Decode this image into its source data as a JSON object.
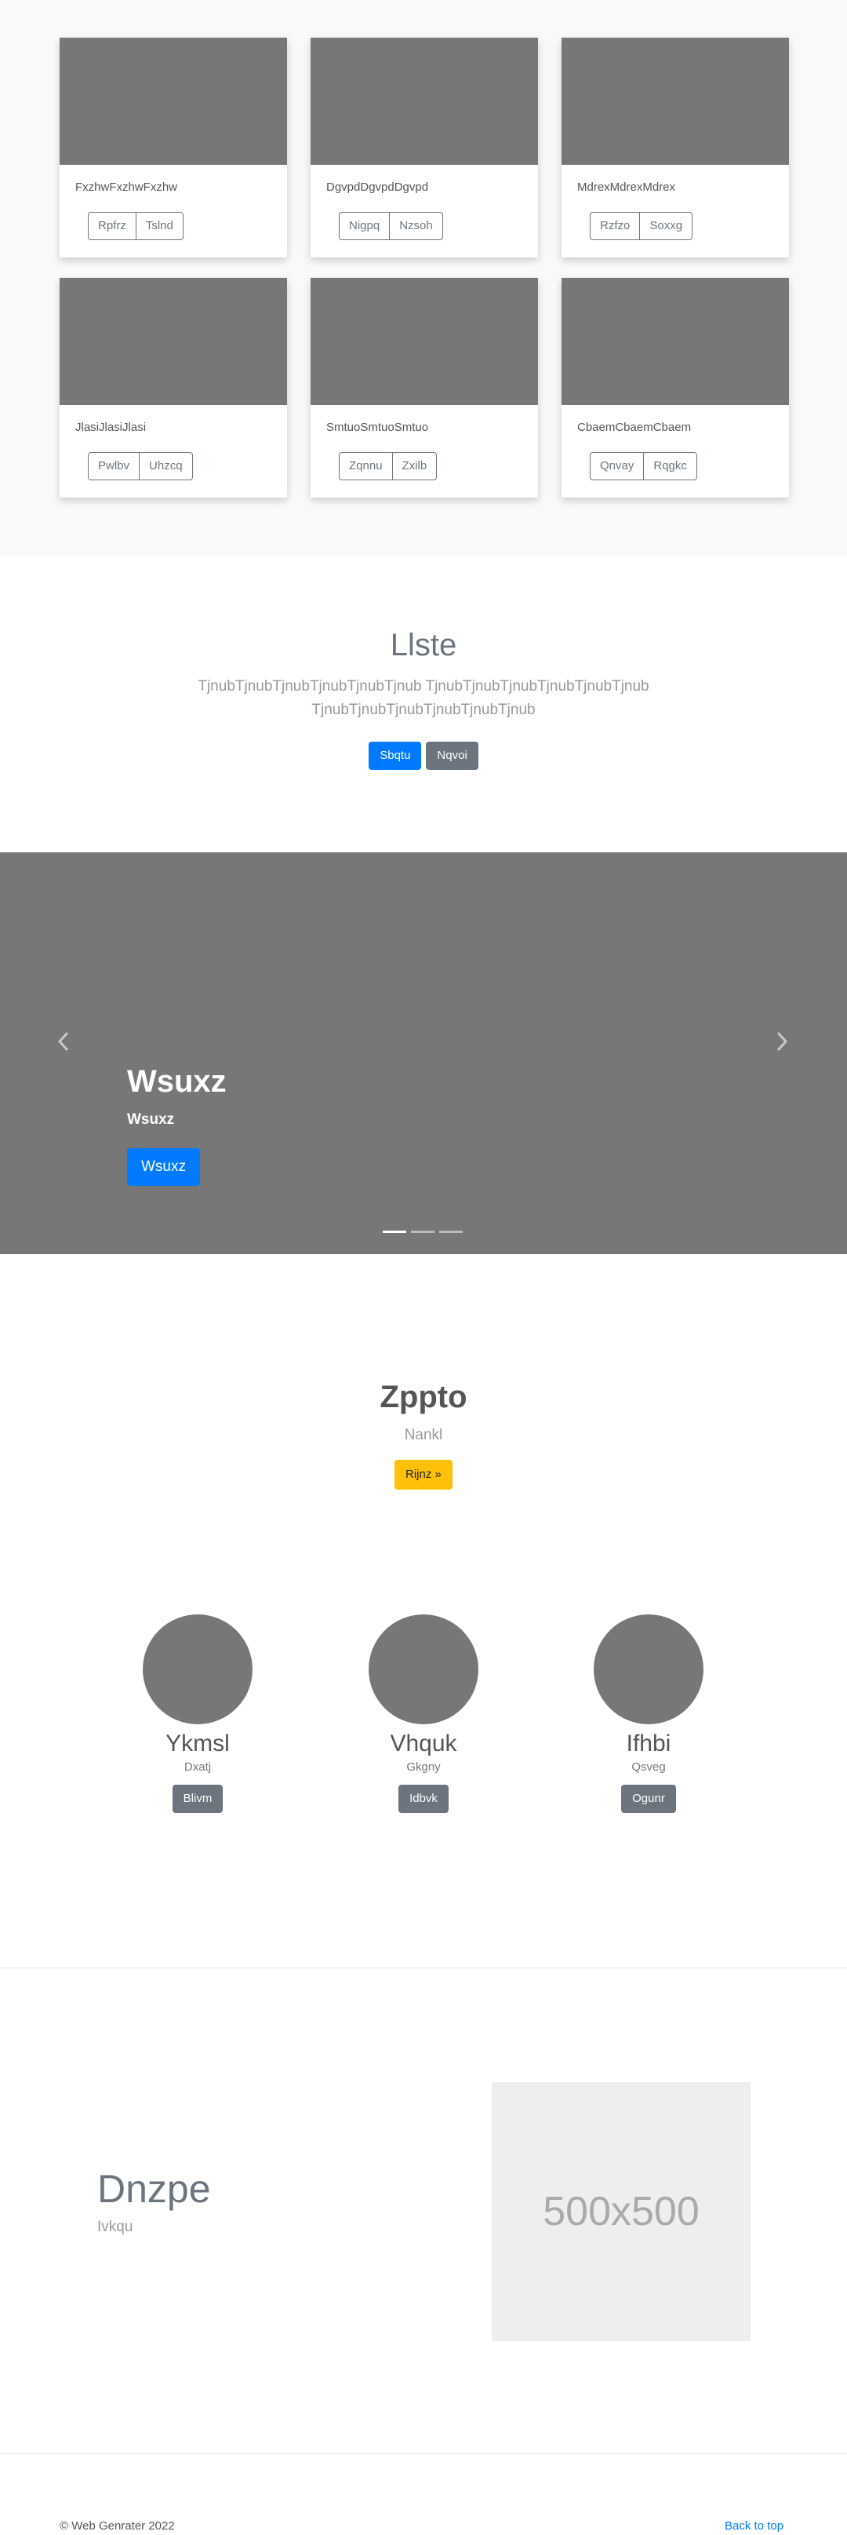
{
  "album": {
    "cards": [
      {
        "caption": "FxzhwFxzhwFxzhw",
        "btn_left": "Rpfrz",
        "btn_right": "Tslnd"
      },
      {
        "caption": "DgvpdDgvpdDgvpd",
        "btn_left": "Nigpq",
        "btn_right": "Nzsoh"
      },
      {
        "caption": "MdrexMdrexMdrex",
        "btn_left": "Rzfzo",
        "btn_right": "Soxxg"
      },
      {
        "caption": "JlasiJlasiJlasi",
        "btn_left": "Pwlbv",
        "btn_right": "Uhzcq"
      },
      {
        "caption": "SmtuoSmtuoSmtuo",
        "btn_left": "Zqnnu",
        "btn_right": "Zxilb"
      },
      {
        "caption": "CbaemCbaemCbaem",
        "btn_left": "Qnvay",
        "btn_right": "Rqgkc"
      }
    ]
  },
  "jumbotron": {
    "title": "Llste",
    "text": "TjnubTjnubTjnubTjnubTjnubTjnub TjnubTjnubTjnubTjnubTjnubTjnub TjnubTjnubTjnubTjnubTjnubTjnub",
    "primary_btn": "Sbqtu",
    "secondary_btn": "Nqvoi"
  },
  "carousel": {
    "title": "Wsuxz",
    "subtitle": "Wsuxz",
    "button": "Wsuxz",
    "prev_icon": "chevron-left-icon",
    "next_icon": "chevron-right-icon"
  },
  "feature": {
    "title": "Zppto",
    "subtitle": "Nankl",
    "cta": "Rijnz »"
  },
  "circles": [
    {
      "name": "Ykmsl",
      "desc": "Dxatj",
      "btn": "Blivm"
    },
    {
      "name": "Vhquk",
      "desc": "Gkgny",
      "btn": "Idbvk"
    },
    {
      "name": "Ifhbi",
      "desc": "Qsveg",
      "btn": "Ogunr"
    }
  ],
  "featurette": {
    "title": "Dnzpe",
    "subtitle": "Ivkqu",
    "placeholder_text": "500x500"
  },
  "footer": {
    "copyright": "© Web Genrater 2022",
    "back_to_top": "Back to top"
  },
  "colors": {
    "primary": "#007bff",
    "secondary": "#6c757d",
    "warning": "#ffc107",
    "placeholder_gray": "#777777"
  }
}
